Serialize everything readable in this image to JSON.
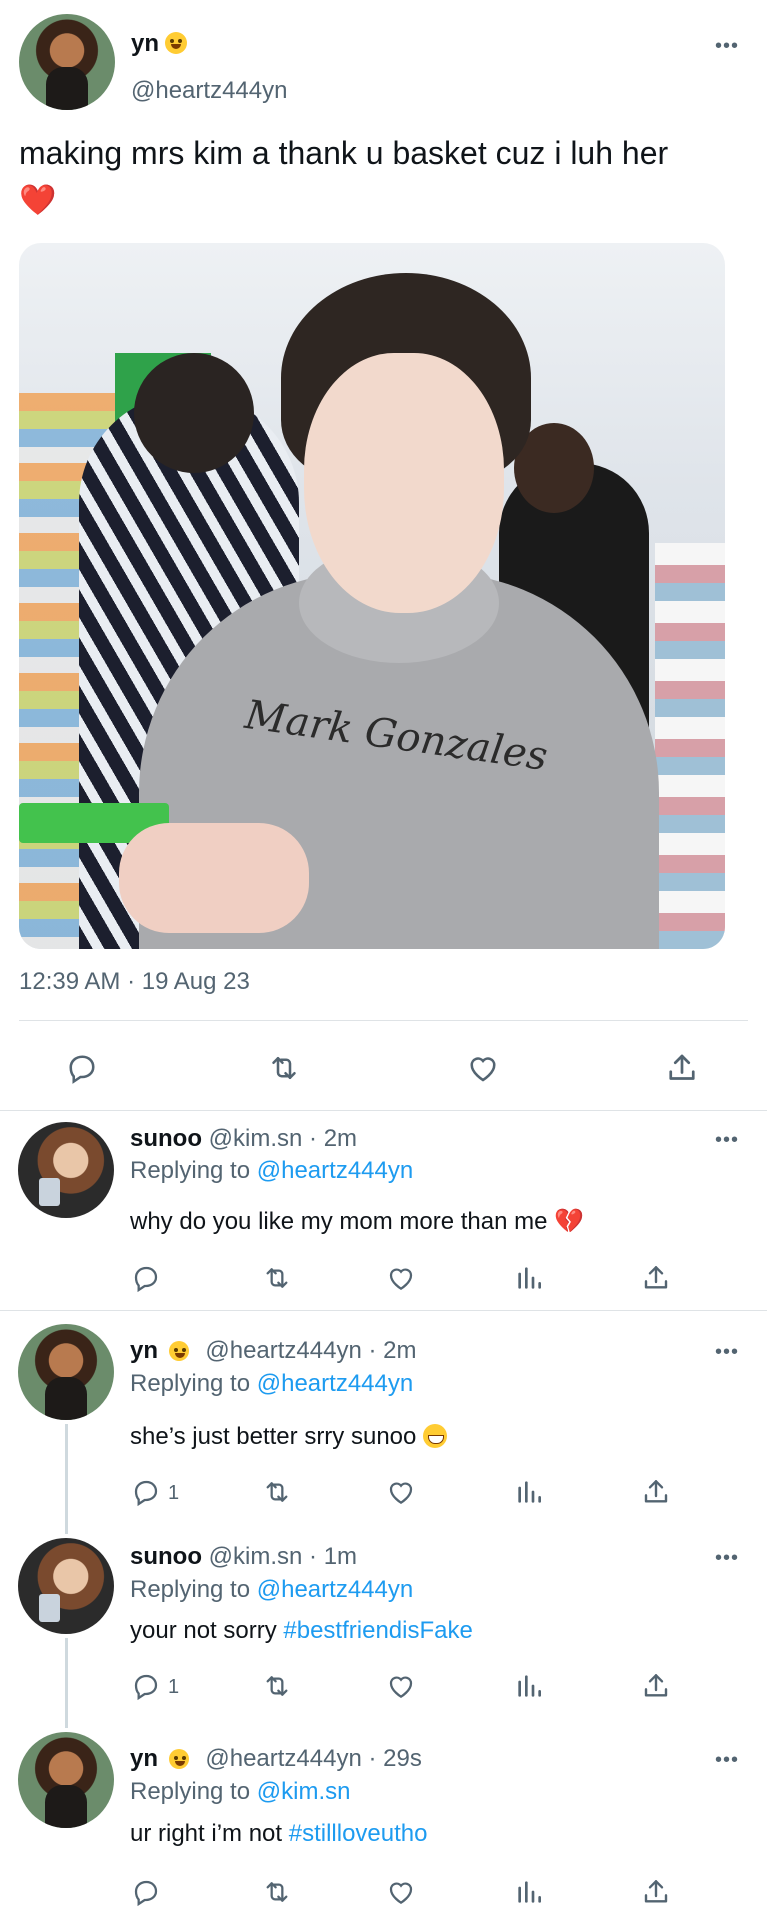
{
  "main_tweet": {
    "name": "yn",
    "handle": "@heartz444yn",
    "text": "making mrs kim a thank u basket cuz i luh her",
    "text_emoji": "❤️",
    "photo_print_text": "Mark Gonzales",
    "timestamp": "12:39 AM · 19 Aug 23",
    "more_label": "•••"
  },
  "replies": [
    {
      "name": "sunoo",
      "meta": "@kim.sn · 2m",
      "replying_prefix": "Replying to ",
      "replying_to": "@heartz444yn",
      "text": "why do you like my mom more than me",
      "text_emoji": "💔",
      "reply_count": ""
    },
    {
      "name": "yn",
      "meta": "@heartz444yn · 2m",
      "replying_prefix": "Replying to ",
      "replying_to": "@heartz444yn",
      "text": "she’s just better srry sunoo",
      "reply_count": "1"
    },
    {
      "name": "sunoo",
      "meta": "@kim.sn · 1m",
      "replying_prefix": "Replying to ",
      "replying_to": "@heartz444yn",
      "text": "your not sorry ",
      "hashtag": "#bestfriendisFake",
      "reply_count": "1"
    },
    {
      "name": "yn",
      "meta": "@heartz444yn · 29s",
      "replying_prefix": "Replying to ",
      "replying_to": "@kim.sn",
      "text": "ur right i’m not ",
      "hashtag": "#stillloveutho",
      "reply_count": ""
    }
  ],
  "colors": {
    "text": "#0f1419",
    "secondary": "#536471",
    "link": "#1d9bf0",
    "divider": "#dfe3e6"
  },
  "icons": [
    "reply-icon",
    "retweet-icon",
    "like-icon",
    "views-icon",
    "share-icon",
    "more-icon"
  ]
}
